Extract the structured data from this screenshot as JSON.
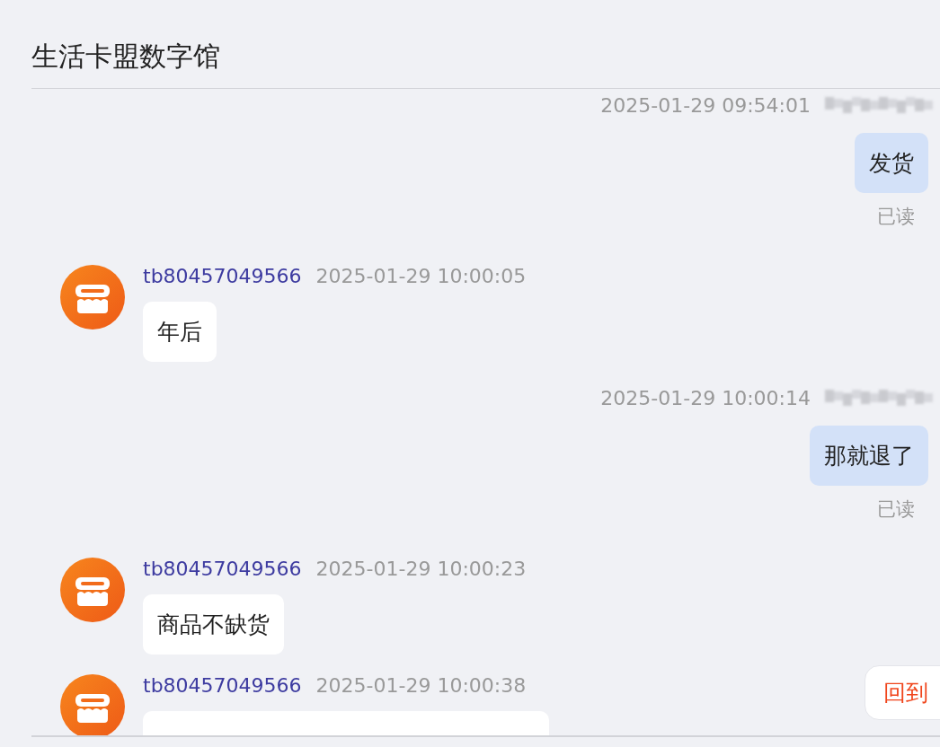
{
  "title": "生活卡盟数字馆",
  "messages": [
    {
      "kind": "sent",
      "time": "2025-01-29 09:54:01",
      "text": "发货",
      "status": "已读"
    },
    {
      "kind": "received",
      "sender": "tb80457049566",
      "time": "2025-01-29 10:00:05",
      "text": "年后"
    },
    {
      "kind": "sent",
      "time": "2025-01-29 10:00:14",
      "text": "那就退了",
      "status": "已读"
    },
    {
      "kind": "received",
      "sender": "tb80457049566",
      "time": "2025-01-29 10:00:23",
      "text": "商品不缺货"
    },
    {
      "kind": "received",
      "sender": "tb80457049566",
      "time": "2025-01-29 10:00:38"
    }
  ],
  "back_to_bottom": {
    "label": "回到"
  }
}
